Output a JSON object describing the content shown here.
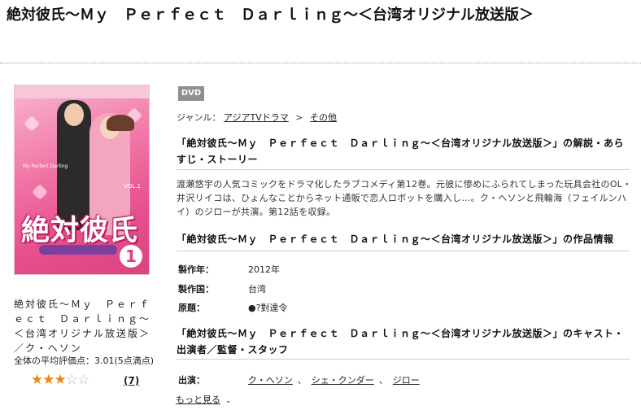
{
  "page": {
    "title": "絶対彼氏～Ｍｙ　Ｐｅｒｆｅｃｔ　Ｄａｒｌｉｎｇ～＜台湾オリジナル放送版＞"
  },
  "product": {
    "cover_logo": "絶対彼氏",
    "cover_disc_number": "1",
    "caption": "絶対彼氏～Ｍｙ　Ｐｅｒｆｅｃｔ　Ｄａｒｌｉｎｇ～＜台湾オリジナル放送版＞／ク・ヘソン",
    "average_rating_text": "全体の平均評価点：3.01(5点満点)",
    "rating_value": 3,
    "rating_max": 5,
    "review_count": "(7)",
    "format_badge": "DVD"
  },
  "genre": {
    "label": "ジャンル：",
    "items": [
      "アジアTVドラマ",
      "その他"
    ],
    "separator": ">"
  },
  "sections": {
    "story_heading": "「絶対彼氏～Ｍｙ　Ｐｅｒｆｅｃｔ　Ｄａｒｌｉｎｇ～＜台湾オリジナル放送版＞」の解説・あらすじ・ストーリー",
    "story_text": "渡瀬悠宇の人気コミックをドラマ化したラブコメディ第12巻。元彼に惨めにふられてしまった玩具会社のOL・井沢リイコは、ひょんなことからネット通販で恋人ロボットを購入し…。ク・ヘソンと飛輪海（フェイルンハイ）のジローが共演。第12話を収録。",
    "info_heading": "「絶対彼氏～Ｍｙ　Ｐｅｒｆｅｃｔ　Ｄａｒｌｉｎｇ～＜台湾オリジナル放送版＞」の作品情報",
    "info_rows": [
      {
        "label": "製作年：",
        "value": "2012年"
      },
      {
        "label": "製作国：",
        "value": "台湾"
      },
      {
        "label": "原題：",
        "value": "●?對達令"
      }
    ],
    "cast_heading": "「絶対彼氏～Ｍｙ　Ｐｅｒｆｅｃｔ　Ｄａｒｌｉｎｇ～＜台湾オリジナル放送版＞」のキャスト・出演者／監督・スタッフ",
    "cast_label": "出演：",
    "cast": [
      "ク・ヘソン",
      "シェ・クンダー",
      "ジロー"
    ],
    "more_label": "もっと見る"
  }
}
